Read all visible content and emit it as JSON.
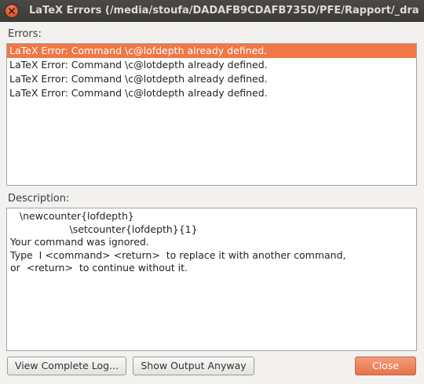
{
  "window": {
    "title": "LaTeX Errors (/media/stoufa/DADAFB9CDAFB735D/PFE/Rapport/_dra"
  },
  "errors": {
    "label": "Errors:",
    "items": [
      "LaTeX Error: Command \\c@lofdepth already defined.",
      "LaTeX Error: Command \\c@lotdepth already defined.",
      "LaTeX Error: Command \\c@lotdepth already defined.",
      "LaTeX Error: Command \\c@lotdepth already defined."
    ],
    "selected_index": 0
  },
  "description": {
    "label": "Description:",
    "lines": [
      "   \\newcounter{lofdepth}",
      "                   \\setcounter{lofdepth}{1}",
      "Your command was ignored.",
      "Type  I <command> <return>  to replace it with another command,",
      "or  <return>  to continue without it."
    ]
  },
  "buttons": {
    "view_log": "View Complete Log...",
    "show_output": "Show Output Anyway",
    "close": "Close"
  },
  "colors": {
    "selection": "#f07746",
    "close_button": "#e7734b",
    "titlebar": "#3c3b37"
  }
}
